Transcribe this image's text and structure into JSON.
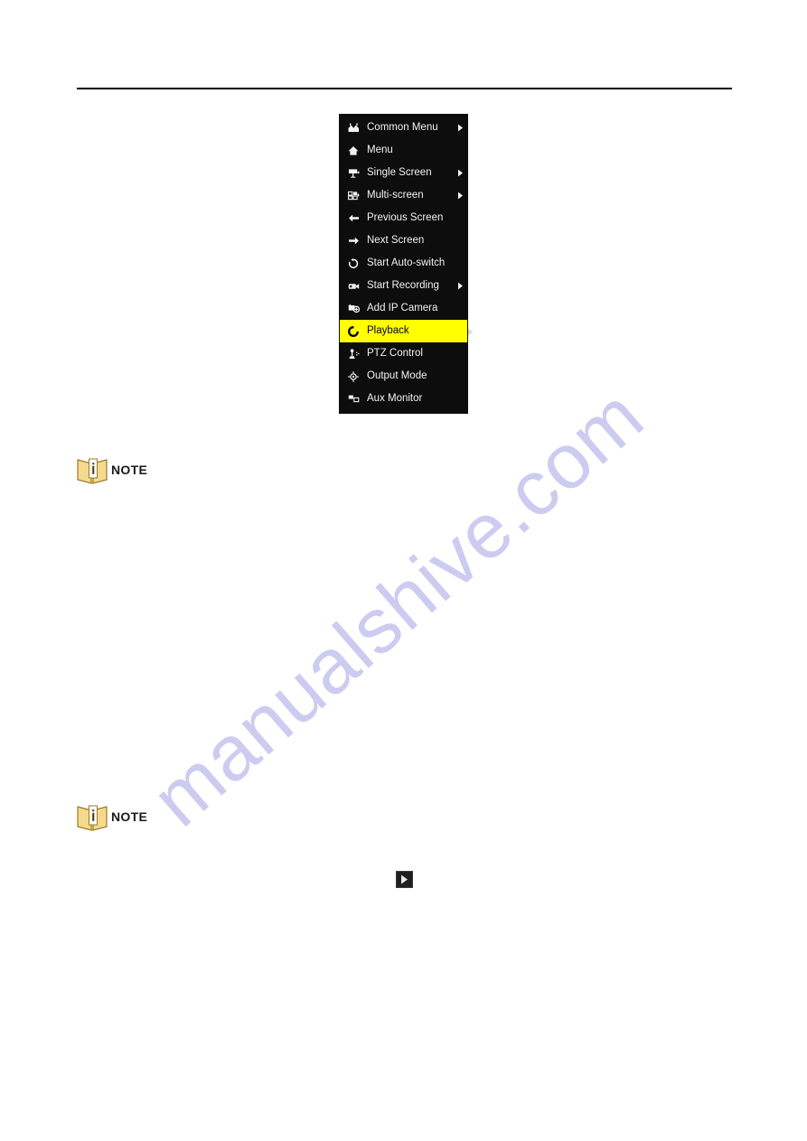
{
  "page": {
    "background_color": "#ffffff",
    "rule_color": "#000000"
  },
  "watermark": {
    "text": "manualshive.com",
    "color": "#ccccf0"
  },
  "context_menu": {
    "background_color": "#0d0d0d",
    "text_color": "#f2f2f2",
    "highlight_color": "#ffff00",
    "highlight_text_color": "#000000",
    "items": [
      {
        "label": "Common Menu",
        "icon": "double-house-icon",
        "submenu": true,
        "selected": false
      },
      {
        "label": "Menu",
        "icon": "house-icon",
        "submenu": false,
        "selected": false
      },
      {
        "label": "Single Screen",
        "icon": "camera-icon",
        "submenu": true,
        "selected": false
      },
      {
        "label": "Multi-screen",
        "icon": "grid-screens-icon",
        "submenu": true,
        "selected": false
      },
      {
        "label": "Previous Screen",
        "icon": "arrow-left-icon",
        "submenu": false,
        "selected": false
      },
      {
        "label": "Next Screen",
        "icon": "arrow-right-icon",
        "submenu": false,
        "selected": false
      },
      {
        "label": "Start Auto-switch",
        "icon": "refresh-icon",
        "submenu": false,
        "selected": false
      },
      {
        "label": "Start Recording",
        "icon": "camcorder-icon",
        "submenu": true,
        "selected": false
      },
      {
        "label": "Add IP Camera",
        "icon": "camera-plus-icon",
        "submenu": false,
        "selected": false
      },
      {
        "label": "Playback",
        "icon": "playback-icon",
        "submenu": true,
        "selected": true
      },
      {
        "label": "PTZ Control",
        "icon": "joystick-icon",
        "submenu": false,
        "selected": false
      },
      {
        "label": "Output Mode",
        "icon": "output-mode-icon",
        "submenu": false,
        "selected": false
      },
      {
        "label": "Aux Monitor",
        "icon": "aux-monitor-icon",
        "submenu": false,
        "selected": false
      }
    ]
  },
  "notes": [
    {
      "label": "NOTE",
      "icon": "note-book-icon"
    },
    {
      "label": "NOTE",
      "icon": "note-book-icon"
    }
  ],
  "inline_controls": {
    "play_button": {
      "icon": "play-icon"
    }
  }
}
